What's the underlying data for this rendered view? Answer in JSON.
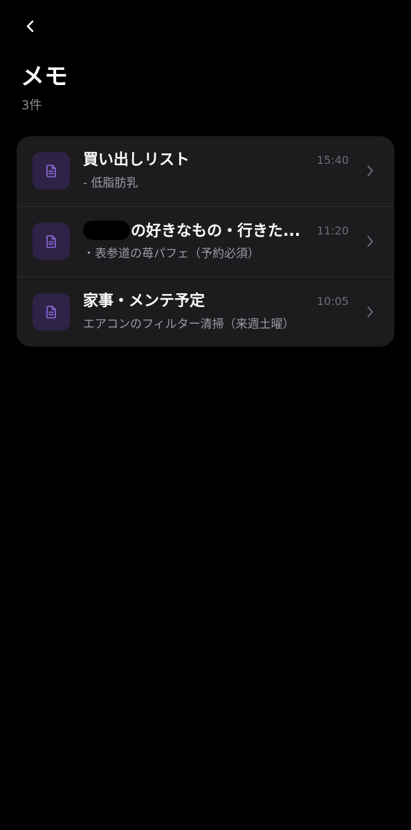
{
  "header": {
    "title": "メモ",
    "count": "3件"
  },
  "icons": {
    "back": "chevron-left-icon",
    "note": "document-icon",
    "disclosure": "chevron-right-icon"
  },
  "colors": {
    "background": "#000000",
    "card": "#1c1c1f",
    "icon_tile": "#2e2346",
    "icon_accent": "#8a63d2",
    "secondary_text": "#9a9aa4",
    "time_text": "#6c6c75"
  },
  "notes": [
    {
      "title": "買い出しリスト",
      "preview": "- 低脂肪乳",
      "time": "15:40"
    },
    {
      "title_redacted": true,
      "title": "の好きなもの・行きた...",
      "preview": "・表参道の苺パフェ（予約必須）",
      "time": "11:20"
    },
    {
      "title": "家事・メンテ予定",
      "preview": "エアコンのフィルター清掃（来週土曜）",
      "time": "10:05"
    }
  ]
}
